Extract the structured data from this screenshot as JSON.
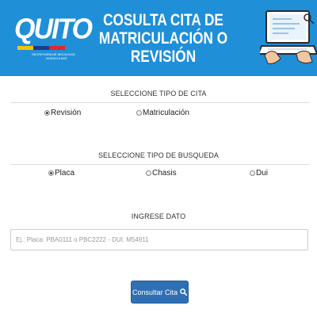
{
  "header": {
    "logo_text": "QUITO",
    "logo_subtitle": "SECRETARÍA DE MOVILIDAD",
    "logo_subtitle2": "AGENCIA AMT",
    "title_line1": "COSULTA CITA DE",
    "title_line2": "MATRICULACIÓN O REVISIÓN",
    "background_color": "#1f8fd8"
  },
  "tipo_cita": {
    "label": "SELECCIONE TIPO DE CITA",
    "options": [
      {
        "label": "Revisión",
        "checked": true
      },
      {
        "label": "Matriculación",
        "checked": false
      }
    ]
  },
  "tipo_busqueda": {
    "label": "SELECCIONE TIPO DE BUSQUEDA",
    "options": [
      {
        "label": "Placa",
        "checked": true
      },
      {
        "label": "Chasis",
        "checked": false
      },
      {
        "label": "Dui",
        "checked": false
      }
    ]
  },
  "dato": {
    "label": "INGRESE DATO",
    "placeholder": "Ej.: Placa: PBA0111 o PBC2222 - DUI: M54911",
    "value": ""
  },
  "submit": {
    "label": "Consultar Cita",
    "icon": "search-icon",
    "color": "#2f70b4"
  }
}
